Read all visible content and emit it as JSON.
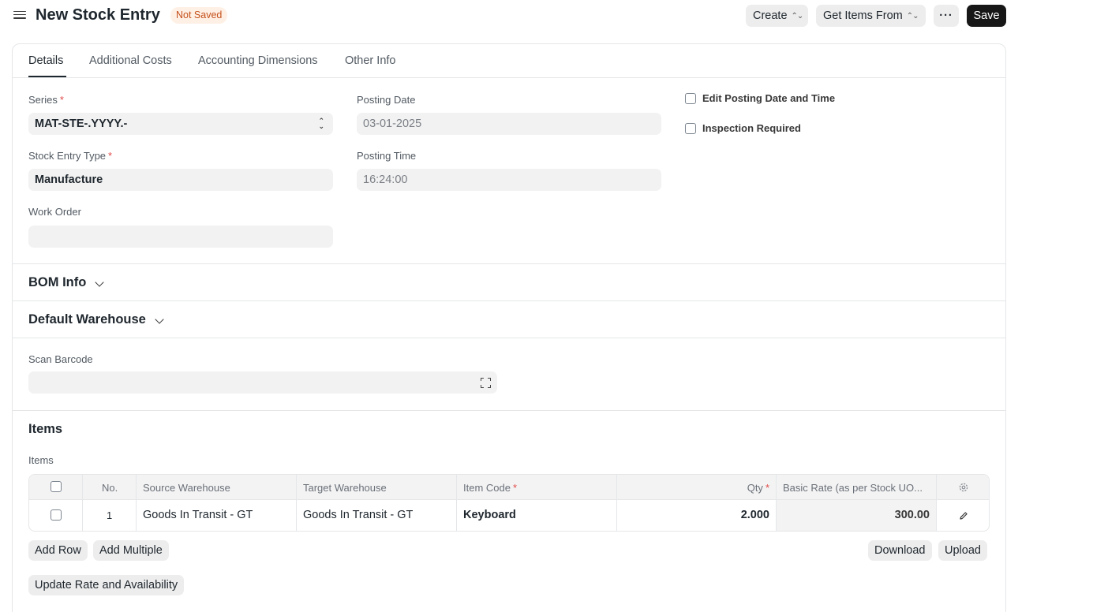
{
  "header": {
    "title": "New Stock Entry",
    "status_badge": "Not Saved",
    "buttons": {
      "create": "Create",
      "get_items_from": "Get Items From",
      "more": "···",
      "save": "Save"
    }
  },
  "tabs": [
    "Details",
    "Additional Costs",
    "Accounting Dimensions",
    "Other Info"
  ],
  "details": {
    "series": {
      "label": "Series",
      "required": "*",
      "value": "MAT-STE-.YYYY.-"
    },
    "stock_entry_type": {
      "label": "Stock Entry Type",
      "required": "*",
      "value": "Manufacture"
    },
    "work_order": {
      "label": "Work Order",
      "value": ""
    },
    "posting_date": {
      "label": "Posting Date",
      "value": "03-01-2025"
    },
    "posting_time": {
      "label": "Posting Time",
      "value": "16:24:00"
    },
    "edit_posting": {
      "label": "Edit Posting Date and Time",
      "checked": false
    },
    "inspection_required": {
      "label": "Inspection Required",
      "checked": false
    }
  },
  "sections": {
    "bom_info": "BOM Info",
    "default_warehouse": "Default Warehouse",
    "items": "Items"
  },
  "scan_barcode": {
    "label": "Scan Barcode",
    "value": ""
  },
  "items_table": {
    "label": "Items",
    "columns": {
      "no": "No.",
      "source_warehouse": "Source Warehouse",
      "target_warehouse": "Target Warehouse",
      "item_code": "Item Code",
      "item_code_required": "*",
      "qty": "Qty",
      "qty_required": "*",
      "basic_rate": "Basic Rate (as per Stock UO..."
    },
    "rows": [
      {
        "no": "1",
        "source_warehouse": "Goods In Transit - GT",
        "target_warehouse": "Goods In Transit - GT",
        "item_code": "Keyboard",
        "qty": "2.000",
        "basic_rate": "300.00"
      }
    ]
  },
  "table_buttons": {
    "add_row": "Add Row",
    "add_multiple": "Add Multiple",
    "download": "Download",
    "upload": "Upload",
    "update_rate": "Update Rate and Availability"
  }
}
